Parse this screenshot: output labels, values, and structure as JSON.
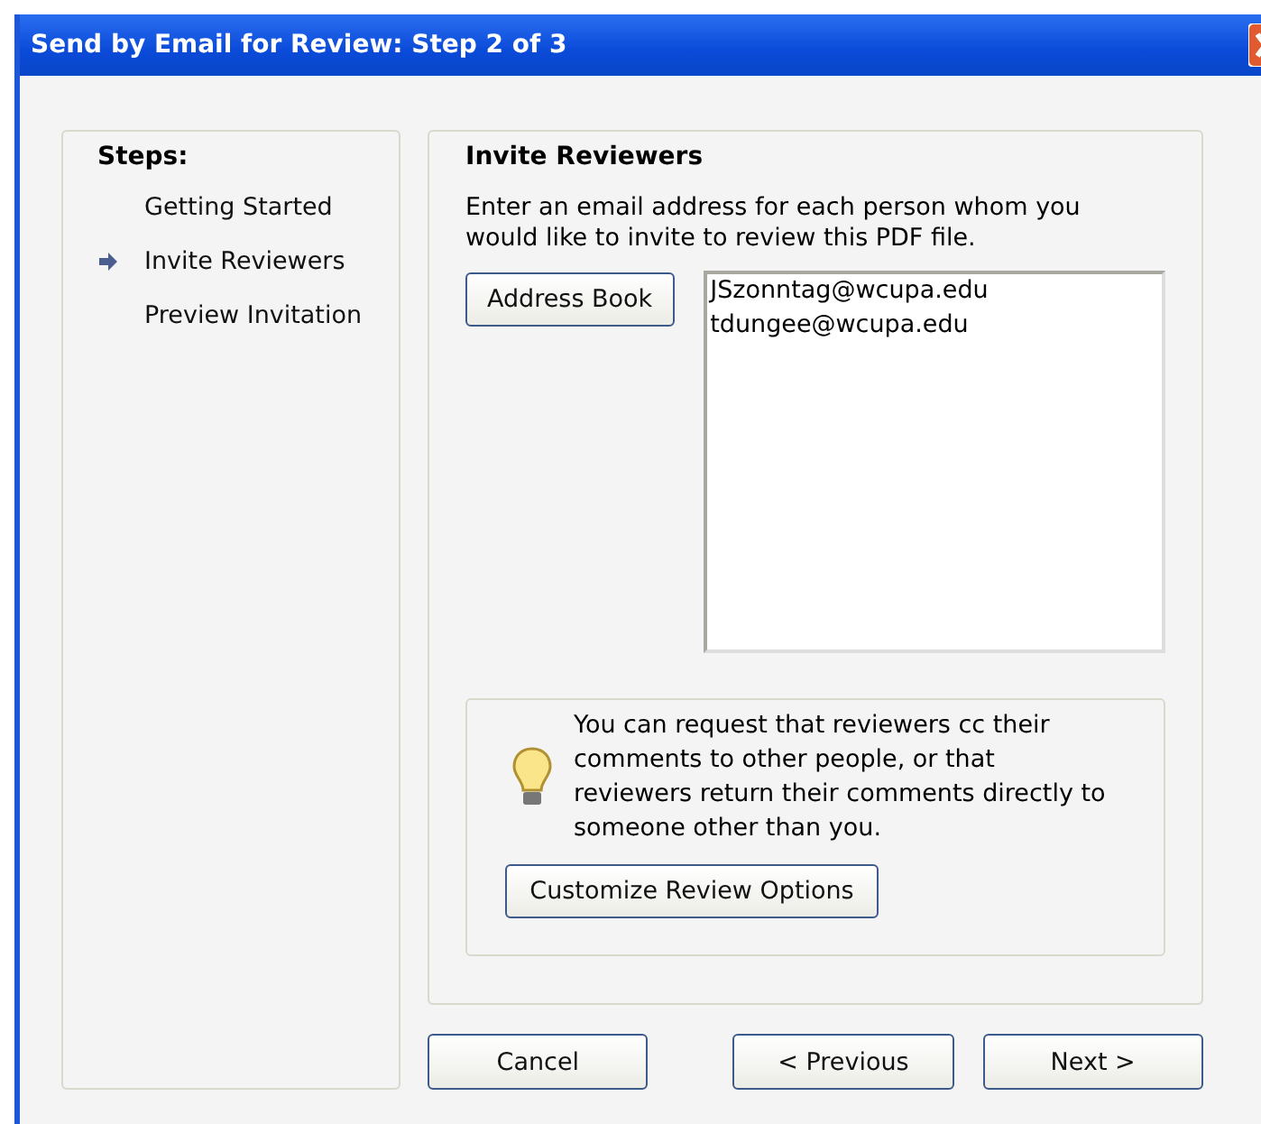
{
  "window": {
    "title": "Send by Email for Review: Step 2 of 3"
  },
  "steps": {
    "heading": "Steps:",
    "items": [
      {
        "label": "Getting Started",
        "selected": false
      },
      {
        "label": "Invite Reviewers",
        "selected": true
      },
      {
        "label": "Preview Invitation",
        "selected": false
      }
    ]
  },
  "main": {
    "heading": "Invite Reviewers",
    "instructions": "Enter an email address for each person whom you would like to invite to review this PDF file.",
    "address_book_button": "Address Book",
    "emails": [
      "JSzonntag@wcupa.edu",
      "tdungee@wcupa.edu"
    ],
    "tip": {
      "text": "You can request that reviewers cc their comments to other people, or that reviewers return their comments directly to someone other than you.",
      "button": "Customize Review Options"
    }
  },
  "buttons": [
    {
      "label": "Cancel"
    },
    {
      "label": "< Previous"
    },
    {
      "label": "Next >"
    }
  ]
}
